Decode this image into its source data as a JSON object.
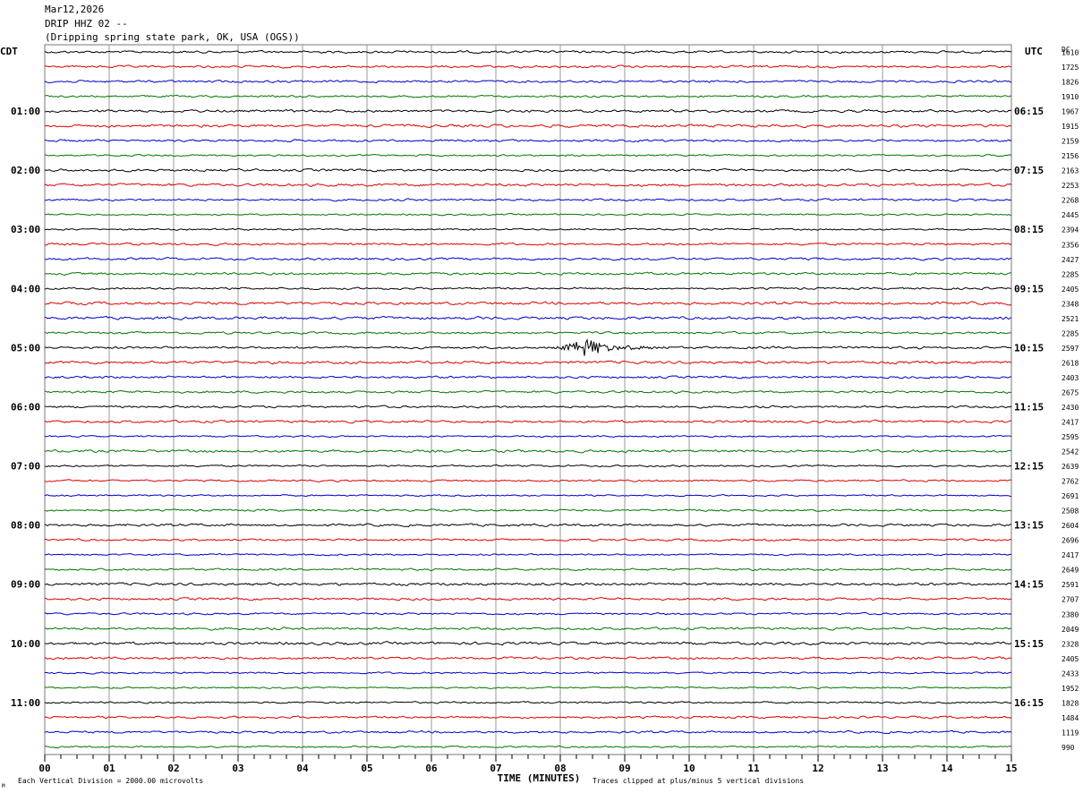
{
  "header": {
    "date": "Mar12,2026",
    "station": "DRIP HHZ 02 --",
    "location": "(Dripping spring state park, OK, USA (OGS))"
  },
  "axes": {
    "left_timezone": "CDT",
    "right_timezone": "UTC",
    "dc_label": "DC",
    "left_hour_labels": [
      "01:00",
      "02:00",
      "03:00",
      "04:00",
      "05:00",
      "06:00",
      "07:00",
      "08:00",
      "09:00",
      "10:00",
      "11:00"
    ],
    "right_hour_labels": [
      "06:15",
      "07:15",
      "08:15",
      "09:15",
      "10:15",
      "11:15",
      "12:15",
      "13:15",
      "14:15",
      "15:15",
      "16:15"
    ],
    "x_tick_labels": [
      "00",
      "01",
      "02",
      "03",
      "04",
      "05",
      "06",
      "07",
      "08",
      "09",
      "10",
      "11",
      "12",
      "13",
      "14",
      "15"
    ]
  },
  "footer": {
    "scale_note": "Each Vertical Division = 2000.00 microvolts",
    "xlabel": "TIME (MINUTES)",
    "clip_note": "Traces clipped at plus/minus 5 vertical divisions",
    "corner_mark": "M"
  },
  "chart_data": {
    "type": "line",
    "subtype": "helicorder",
    "minutes_per_line": 15,
    "xlim": [
      0,
      15
    ],
    "trace_colors": [
      "#000000",
      "#dd0000",
      "#0000cc",
      "#007700"
    ],
    "lines": 48,
    "dc_offsets": [
      "1610",
      "1725",
      "1826",
      "1910",
      "1967",
      "1915",
      "2159",
      "2156",
      "2163",
      "2253",
      "2268",
      "2445",
      "2394",
      "2356",
      "2427",
      "2285",
      "2405",
      "2348",
      "2521",
      "2285",
      "2597",
      "2618",
      "2403",
      "2675",
      "2430",
      "2417",
      "2595",
      "2542",
      "2639",
      "2762",
      "2691",
      "2508",
      "2604",
      "2696",
      "2417",
      "2649",
      "2591",
      "2707",
      "2380",
      "2049",
      "2328",
      "2405",
      "2433",
      "1952",
      "1828",
      "1484",
      "1119",
      "990"
    ],
    "event": {
      "line_index": 20,
      "start_minute": 7.9,
      "peak_minute": 8.4,
      "end_minute": 9.7
    }
  }
}
